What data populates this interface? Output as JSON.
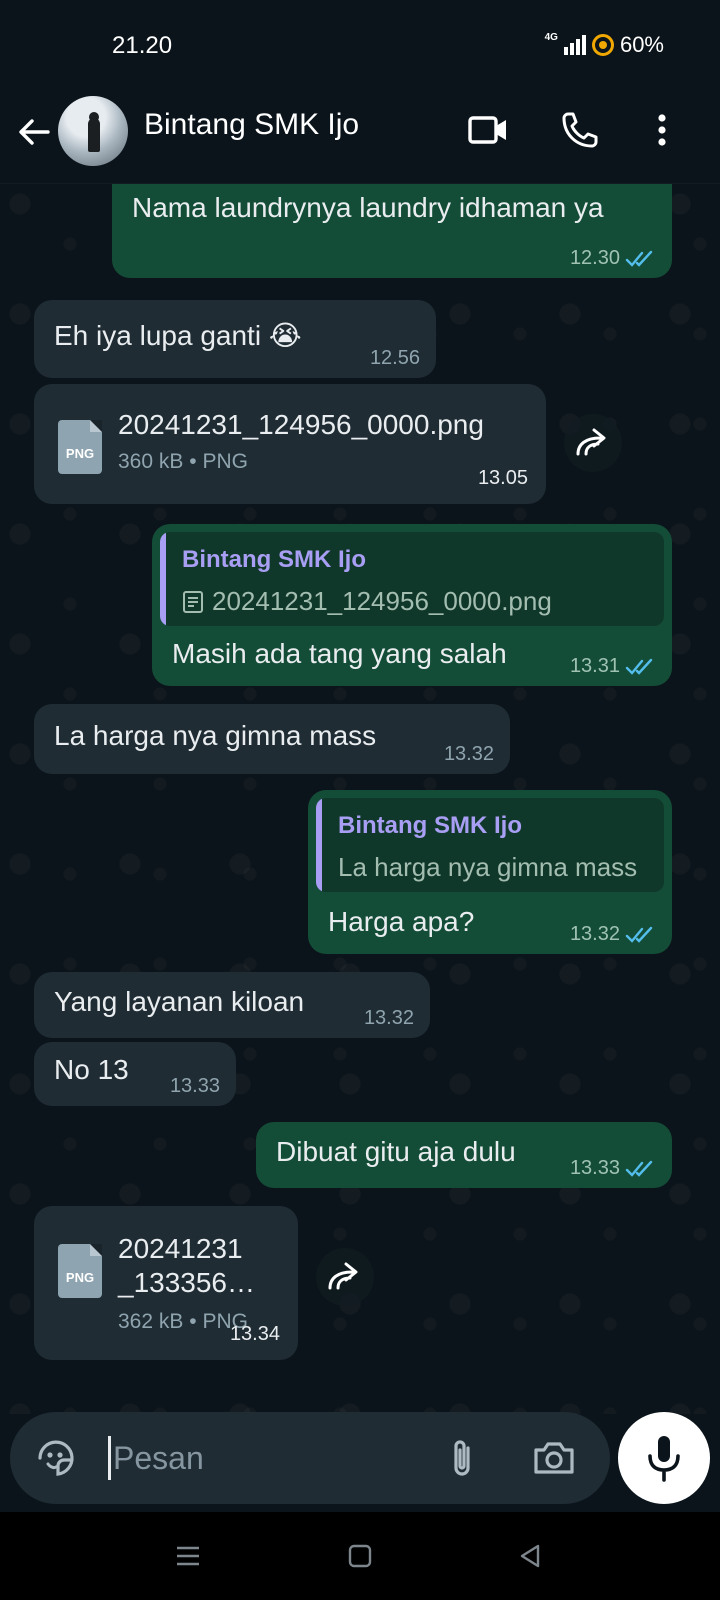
{
  "status": {
    "time": "21.20",
    "network": "4G",
    "battery": "60%"
  },
  "header": {
    "contact_name": "Bintang SMK Ijo"
  },
  "messages": [
    {
      "dir": "out",
      "text": "Nama laundrynya laundry idhaman ya",
      "time": "12.30"
    },
    {
      "dir": "in",
      "text": "Eh iya lupa ganti 😭",
      "time": "12.56"
    },
    {
      "dir": "in",
      "file": {
        "name": "20241231_124956_0000.png",
        "size": "360 kB",
        "type": "PNG",
        "icon_label": "PNG"
      },
      "time": "13.05"
    },
    {
      "dir": "out",
      "quote": {
        "author": "Bintang SMK Ijo",
        "text": "20241231_124956_0000.png"
      },
      "text": "Masih ada tang yang salah",
      "time": "13.31"
    },
    {
      "dir": "in",
      "text": "La harga nya gimna mass",
      "time": "13.32"
    },
    {
      "dir": "out",
      "quote": {
        "author": "Bintang SMK Ijo",
        "text": "La harga nya gimna mass"
      },
      "text": "Harga apa?",
      "time": "13.32"
    },
    {
      "dir": "in",
      "text": "Yang layanan kiloan",
      "time": "13.32"
    },
    {
      "dir": "in",
      "text": "No 13",
      "time": "13.33"
    },
    {
      "dir": "out",
      "text": "Dibuat gitu aja dulu",
      "time": "13.33"
    },
    {
      "dir": "in",
      "file": {
        "name_line1": "20241231",
        "name_line2": "_133356…",
        "size": "362 kB",
        "type": "PNG",
        "icon_label": "PNG"
      },
      "time": "13.34"
    }
  ],
  "input": {
    "placeholder": "Pesan"
  },
  "file_meta_separator": "•",
  "colors": {
    "outgoing_bubble": "#144d37",
    "incoming_bubble": "#1f2c34",
    "read_ticks": "#53bdeb",
    "quote_author": "#a89ef3"
  }
}
